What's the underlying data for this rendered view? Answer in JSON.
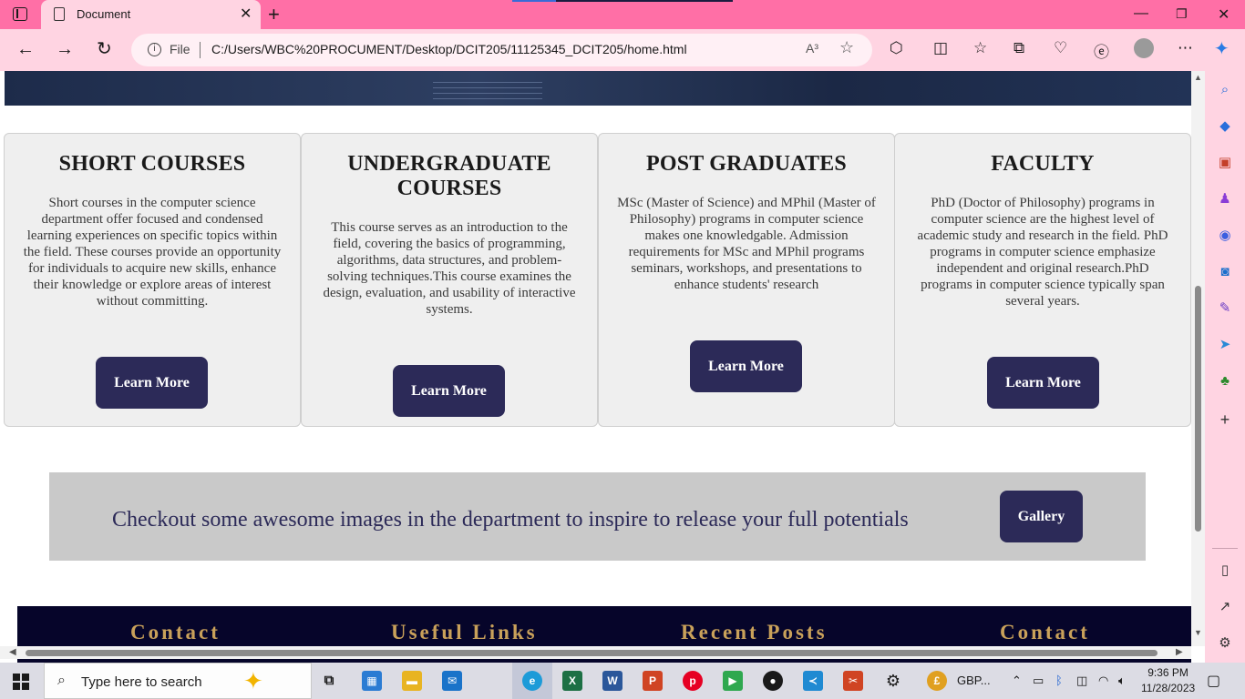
{
  "browser": {
    "tab_title": "Document",
    "address_prefix": "File",
    "url": "C:/Users/WBC%20PROCUMENT/Desktop/DCIT205/11125345_DCIT205/home.html",
    "read_aloud_label": "A³"
  },
  "cards": [
    {
      "title": "SHORT COURSES",
      "body": "Short courses in the computer science department offer focused and condensed learning experiences on specific topics within the field. These courses provide an opportunity for individuals to acquire new skills, enhance their knowledge or explore areas of interest without committing.",
      "button": "Learn More"
    },
    {
      "title": "UNDERGRADUATE COURSES",
      "body": "This course serves as an introduction to the field, covering the basics of programming, algorithms, data structures, and problem-solving techniques.This course examines the design, evaluation, and usability of interactive systems.",
      "button": "Learn More"
    },
    {
      "title": "POST GRADUATES",
      "body": "MSc (Master of Science) and MPhil (Master of Philosophy) programs in computer science makes one knowledgable. Admission requirements for MSc and MPhil programs seminars, workshops, and presentations to enhance students' research",
      "button": "Learn More"
    },
    {
      "title": "FACULTY",
      "body": "PhD (Doctor of Philosophy) programs in computer science are the highest level of academic study and research in the field. PhD programs in computer science emphasize independent and original research.PhD programs in computer science typically span several years.",
      "button": "Learn More"
    }
  ],
  "banner": {
    "text": "Checkout some awesome images in the department to inspire to release your full potentials",
    "button": "Gallery"
  },
  "footer": {
    "headings": [
      "Contact",
      "Useful Links",
      "Recent Posts",
      "Contact"
    ]
  },
  "taskbar": {
    "search_placeholder": "Type here to search",
    "currency_label": "GBP...",
    "time": "9:36 PM",
    "date": "11/28/2023"
  },
  "colors": {
    "primary_button": "#2c2a58",
    "footer_bg": "#06052a",
    "footer_heading": "#c9a15a",
    "browser_frame": "#ff6fa6"
  }
}
